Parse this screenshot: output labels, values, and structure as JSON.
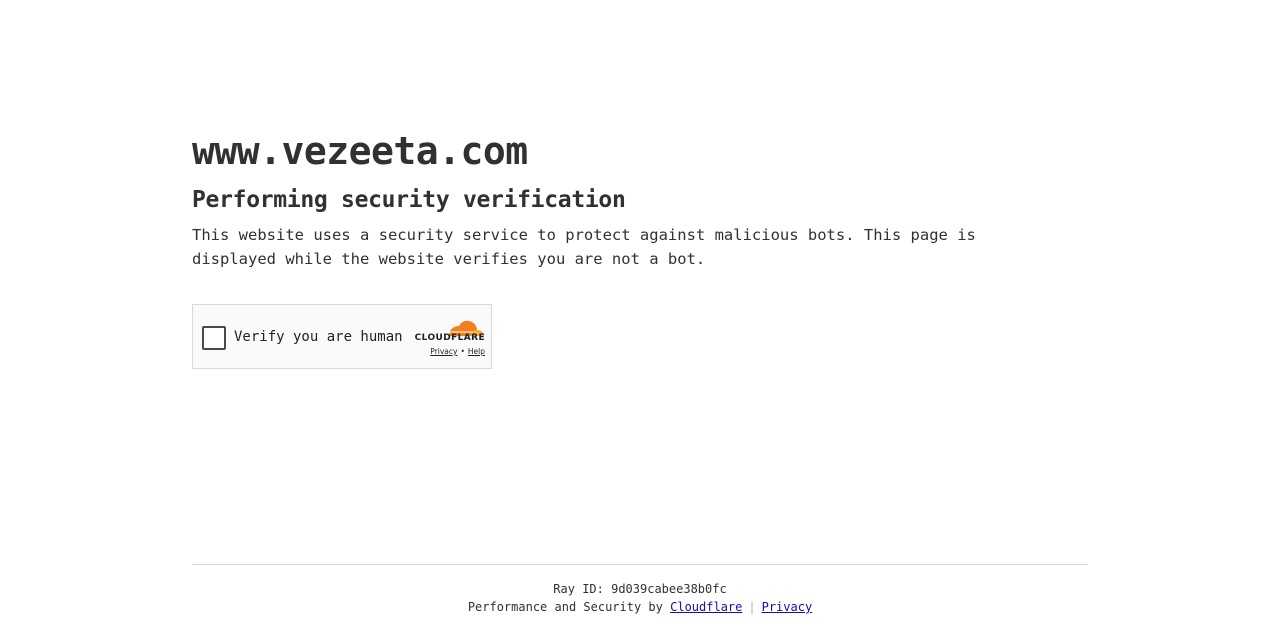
{
  "page": {
    "site": "www.vezeeta.com",
    "heading": "Performing security verification",
    "description": "This website uses a security service to protect against malicious bots. This page is displayed while the website verifies you are not a bot."
  },
  "widget": {
    "label": "Verify you are human",
    "brand": "CLOUDFLARE",
    "privacy_link": "Privacy",
    "separator": "•",
    "help_link": "Help",
    "logo_icon": "cloudflare-cloud-icon",
    "logo_colors": [
      "#f38020",
      "#faae40"
    ]
  },
  "footer": {
    "ray_label": "Ray ID:",
    "ray_id": "9d039cabee38b0fc",
    "perf_text": "Performance and Security by",
    "cloudflare_link": "Cloudflare",
    "separator": "|",
    "privacy_link": "Privacy"
  }
}
